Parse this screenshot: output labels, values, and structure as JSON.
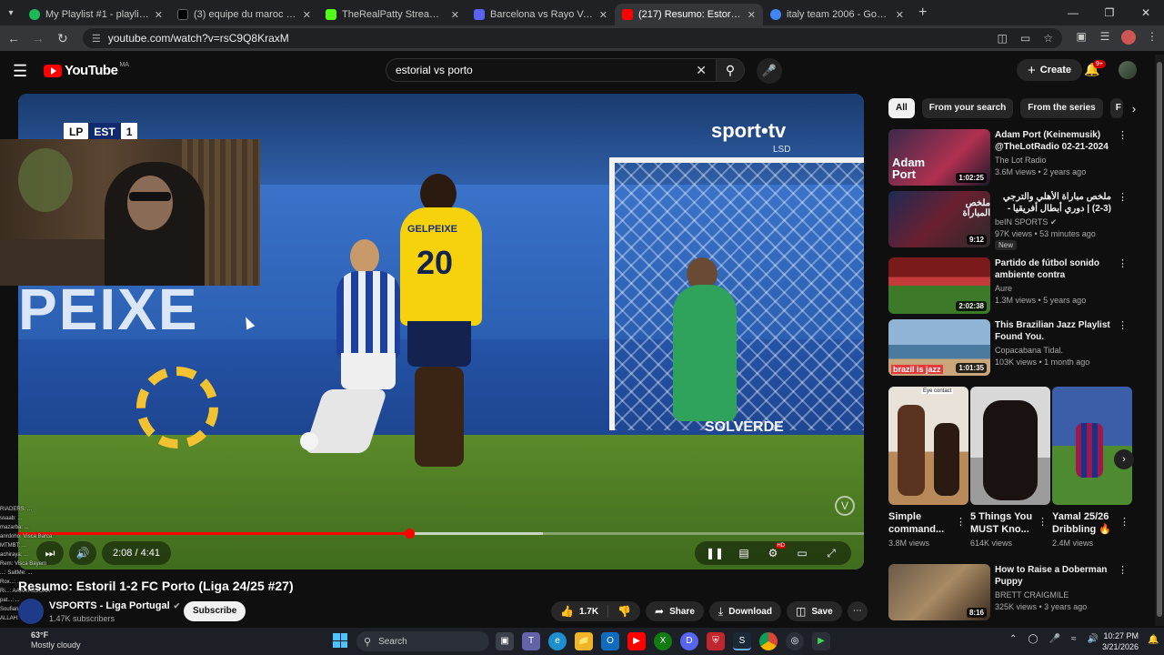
{
  "browser": {
    "tabs": [
      {
        "title": "My Playlist #1 - playlist by lilpa",
        "color": "#1db954",
        "active": false
      },
      {
        "title": "(3) equipe du maroc - Search / X",
        "color": "#000000",
        "active": false
      },
      {
        "title": "TheRealPatty Stream - Watch Live",
        "color": "#53fc18",
        "active": false
      },
      {
        "title": "Barcelona vs Rayo Vallecano live",
        "color": "#5865f2",
        "active": false
      },
      {
        "title": "(217) Resumo: Estoril 1-2 FC Porto",
        "color": "#ff0000",
        "active": true
      },
      {
        "title": "italy team 2006 - Google Search",
        "color": "#4285f4",
        "active": false
      }
    ],
    "url": "youtube.com/watch?v=rsC9Q8KraxM"
  },
  "youtube": {
    "logo_text": "YouTube",
    "country_code": "MA",
    "search_value": "estorial vs porto",
    "create_label": "Create",
    "notification_badge": "9+"
  },
  "player": {
    "current_time": "2:08",
    "duration": "4:41",
    "time_label": "2:08 / 4:41",
    "progress": 0.462,
    "buffered": 0.62,
    "overlay": {
      "scorebug_home": "LP",
      "scorebug_team": "EST",
      "scorebug_score": "1",
      "broadcaster": "sport•tv",
      "broadcaster_sub": "LSD",
      "board_text": "PEIXE",
      "shirt_sponsor": "GELPEIXE",
      "shirt_number": "20",
      "sponsor_board": "SOLVERDE",
      "watermark": "V"
    }
  },
  "stream_chat": [
    "RIADERS: ...",
    "ssaab: ...",
    "mazarba: ...",
    "anrdoho: Visca Barca",
    "MTMBT: ...",
    "achiraya: ...",
    "Rem: Visca Bayern",
    "...: SaltMe: ...",
    "Rox...: ...",
    "Ri...: AAAA ASSUKA",
    "pat...: ...",
    "Soufian: ...",
    "ALLAH: ..."
  ],
  "video": {
    "title": "Resumo: Estoril 1-2 FC Porto (Liga 24/25 #27)",
    "channel": "VSPORTS - Liga Portugal",
    "subscribers": "1.47K subscribers",
    "subscribe_label": "Subscribe",
    "likes": "1.7K",
    "share_label": "Share",
    "download_label": "Download",
    "save_label": "Save"
  },
  "sidebar": {
    "chips": [
      "All",
      "From your search",
      "From the series",
      "F"
    ],
    "recommendations": [
      {
        "title": "Adam Port (Keinemusik) @TheLotRadio 02-21-2024",
        "channel": "The Lot Radio",
        "meta": "3.6M views • 2 years ago",
        "duration": "1:02:25",
        "thumb_text": "Adam Port",
        "is_new": false
      },
      {
        "title": "ملخص مباراة الأهلي والترجي (3-2) | دوري أبطال أفريقيا - إياب الدور ربع",
        "channel": "beIN SPORTS",
        "meta": "97K views • 53 minutes ago",
        "duration": "9:12",
        "thumb_text": "ملخص المباراة",
        "is_new": true,
        "new_label": "New"
      },
      {
        "title": "Partido de fútbol sonido ambiente contra coronavirus...",
        "channel": "Aure",
        "meta": "1.3M views • 5 years ago",
        "duration": "2:02:38",
        "thumb_text": "",
        "is_new": false
      },
      {
        "title": "This Brazilian Jazz Playlist Found You.",
        "channel": "Copacabana Tidal.",
        "meta": "103K views • 1 month ago",
        "duration": "1:01:35",
        "thumb_text": "brazil is jazz",
        "is_new": false
      }
    ],
    "shorts": [
      {
        "title": "Simple command...",
        "views": "3.8M views",
        "thumb_text": "Eye contact"
      },
      {
        "title": "5 Things You MUST Kno...",
        "views": "614K views",
        "thumb_text": ""
      },
      {
        "title": "Yamal 25/26 Dribbling 🔥",
        "views": "2.4M views",
        "thumb_text": ""
      }
    ],
    "last_recommendation": {
      "title": "How to Raise a Doberman Puppy",
      "channel": "BRETT CRAIGMILE",
      "meta": "325K views • 3 years ago",
      "duration": "8:16"
    }
  },
  "taskbar": {
    "weather_temp": "63°F",
    "weather_desc": "Mostly cloudy",
    "search_label": "Search",
    "time": "10:27 PM",
    "date": "3/21/2026"
  },
  "colors": {
    "youtube_red": "#ff0000",
    "background": "#0f0f0f",
    "chip_bg": "#272727"
  }
}
